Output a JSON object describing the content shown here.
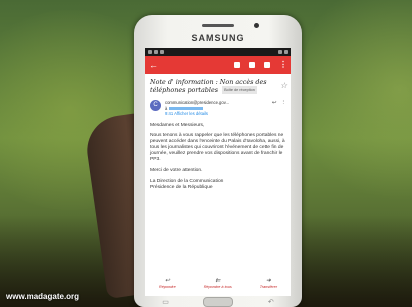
{
  "phone": {
    "brand": "SAMSUNG"
  },
  "email": {
    "subject": "Note d' information : Non accès des téléphones portables",
    "label": "Boîte de réception",
    "sender": {
      "initial": "C",
      "address": "communication@presidence.gov...",
      "to_prefix": "à",
      "details": "9:41  Afficher les détails"
    },
    "body": [
      "Mesdames et Messieurs,",
      "Nous tenons à vous rappeler que les téléphones portables ne peuvent accéder dans l'enceinte du Palais d'Iavoloha, aussi, à tous les journalistes qui couvriront l'événement de cette fin de journée, veuillez prendre vos dispositions avant de franchir le PP3.",
      "Merci de votre attention.",
      "La Direction de la Communication\nPrésidence de la République"
    ],
    "actions": [
      {
        "label": "Répondre",
        "icon": "reply-icon",
        "glyph": "↩"
      },
      {
        "label": "Répondre à tous",
        "icon": "reply-all-icon",
        "glyph": "⇇"
      },
      {
        "label": "Transférer",
        "icon": "forward-icon",
        "glyph": "➜"
      }
    ]
  },
  "watermark": "www.madagate.org",
  "colors": {
    "appbar": "#e53935",
    "avatar": "#5c6bc0"
  }
}
